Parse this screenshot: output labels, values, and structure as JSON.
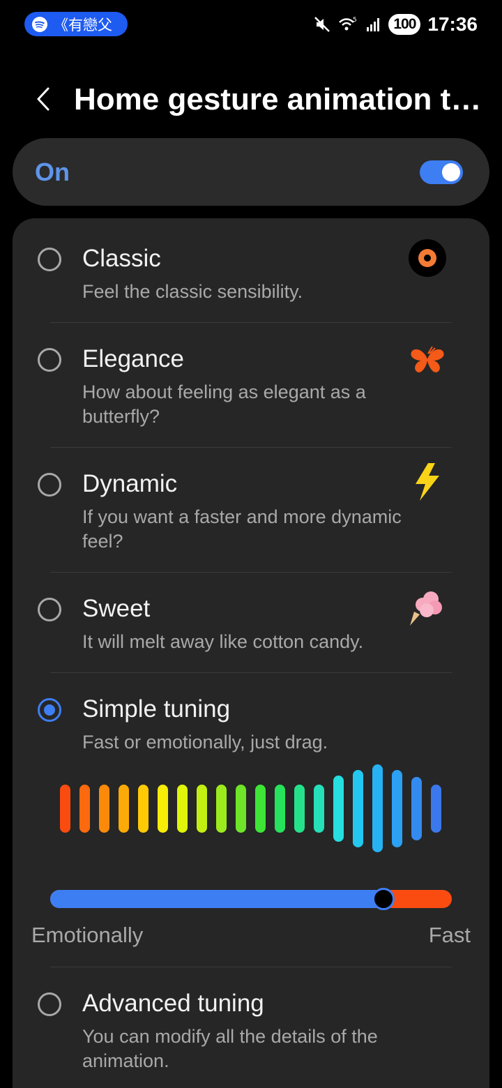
{
  "status_bar": {
    "media_app_icon": "spotify-icon",
    "media_text": "《有戀父",
    "icons": [
      "mute-icon",
      "wifi-5g-icon",
      "signal-icon"
    ],
    "battery": "100",
    "time": "17:36"
  },
  "app_bar": {
    "back_icon": "chevron-left-icon",
    "title": "Home gesture animation tu..."
  },
  "master_switch": {
    "label": "On",
    "checked": true
  },
  "options": [
    {
      "title": "Classic",
      "description": "Feel the classic sensibility.",
      "icon": "target-icon",
      "selected": false
    },
    {
      "title": "Elegance",
      "description": "How about feeling as elegant as a butterfly?",
      "icon": "butterfly-icon",
      "selected": false
    },
    {
      "title": "Dynamic",
      "description": "If you want a faster and more dynamic feel?",
      "icon": "lightning-icon",
      "selected": false
    },
    {
      "title": "Sweet",
      "description": "It will melt away like cotton candy.",
      "icon": "cotton-candy-icon",
      "selected": false
    },
    {
      "title": "Simple tuning",
      "description": "Fast or emotionally, just drag.",
      "icon": "",
      "selected": true
    },
    {
      "title": "Advanced tuning",
      "description": "You can modify all the details of the animation.",
      "icon": "",
      "selected": false
    }
  ],
  "simple_tuning": {
    "slider": {
      "min_label": "Emotionally",
      "max_label": "Fast",
      "value": 0.83
    },
    "equalizer_colors": [
      "#fa4c10",
      "#fb6a0e",
      "#fb8a0a",
      "#fcaa07",
      "#fdca05",
      "#f7ed06",
      "#e0f509",
      "#c3f012",
      "#9ceb1d",
      "#6ee528",
      "#3ee537",
      "#27e25c",
      "#25e28a",
      "#25e0b8",
      "#26dde0",
      "#24c8ee",
      "#26b2f4",
      "#2ca0f2",
      "#348bef",
      "#3a78ec"
    ],
    "active_bar_heights": [
      0.55,
      0.55,
      0.55,
      0.55,
      0.55,
      0.55,
      0.55,
      0.55,
      0.55,
      0.55,
      0.55,
      0.55,
      0.55,
      0.55,
      0.75,
      0.88,
      1.0,
      0.88,
      0.72,
      0.55
    ]
  }
}
